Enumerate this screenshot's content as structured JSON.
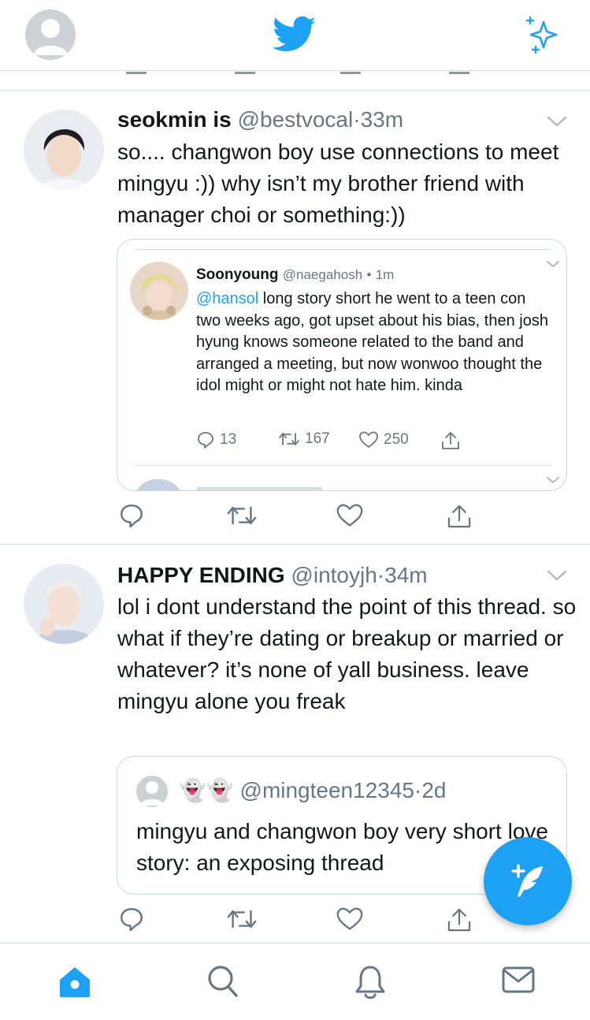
{
  "header": {
    "profile_icon": "default-avatar-icon",
    "logo_icon": "twitter-bird-icon",
    "sparkle_icon": "sparkle-timeline-icon",
    "brand_color": "#1da1f2"
  },
  "tweets": [
    {
      "name": "seokmin is",
      "handle": "@bestvocal",
      "sep": "·",
      "time": "33m",
      "text": "so.... changwon boy use connections to meet mingyu :)) why isn’t my brother friend with manager choi or something:))",
      "quoted": {
        "name": "Soonyoung",
        "handle": "@naegahosh",
        "sep": "•",
        "time": "1m",
        "mention": "@hansol",
        "text": " long story short he went to a teen con two weeks ago, got upset about his bias, then josh hyung knows someone related to the band and arranged a meeting, but now wonwoo thought the idol might or might not hate him. kinda",
        "reply_count": "13",
        "retweet_count": "167",
        "like_count": "250"
      }
    },
    {
      "name": "HAPPY ENDING",
      "handle": "@intoyjh",
      "sep": "·",
      "time": "34m",
      "text": "lol i dont understand the point of this thread. so what if they’re dating or breakup or married or whatever? it’s none of yall business. leave mingyu alone you freak",
      "quoted": {
        "emoji": "👻👻",
        "handle": "@mingteen12345",
        "sep": "·",
        "time": "2d",
        "text": "mingyu and changwon boy very short love story: an exposing thread"
      }
    }
  ],
  "actions_icons": [
    "reply-icon",
    "retweet-icon",
    "like-icon",
    "share-icon"
  ],
  "fab": {
    "icon": "compose-tweet-icon"
  },
  "tabbar": {
    "items": [
      "home-icon",
      "search-icon",
      "notifications-icon",
      "messages-icon"
    ]
  }
}
